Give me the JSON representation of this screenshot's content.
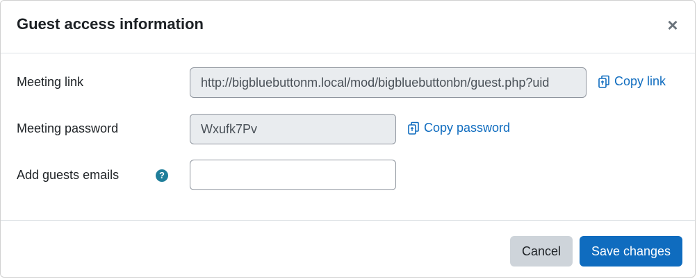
{
  "dialog": {
    "title": "Guest access information",
    "close_label": "×"
  },
  "fields": {
    "meeting_link": {
      "label": "Meeting link",
      "value": "http://bigbluebuttonm.local/mod/bigbluebuttonbn/guest.php?uid",
      "copy_label": "Copy link",
      "copy_icon": "copy-icon"
    },
    "meeting_password": {
      "label": "Meeting password",
      "value": "Wxufk7Pv",
      "copy_label": "Copy password",
      "copy_icon": "copy-icon"
    },
    "guest_emails": {
      "label": "Add guests emails",
      "value": "",
      "help_icon": "question-circle-icon"
    }
  },
  "footer": {
    "cancel_label": "Cancel",
    "save_label": "Save changes"
  },
  "colors": {
    "primary": "#0f6cbf",
    "secondary": "#ced4da",
    "help_icon": "#1f7e9a",
    "readonly_bg": "#e9ecef"
  }
}
